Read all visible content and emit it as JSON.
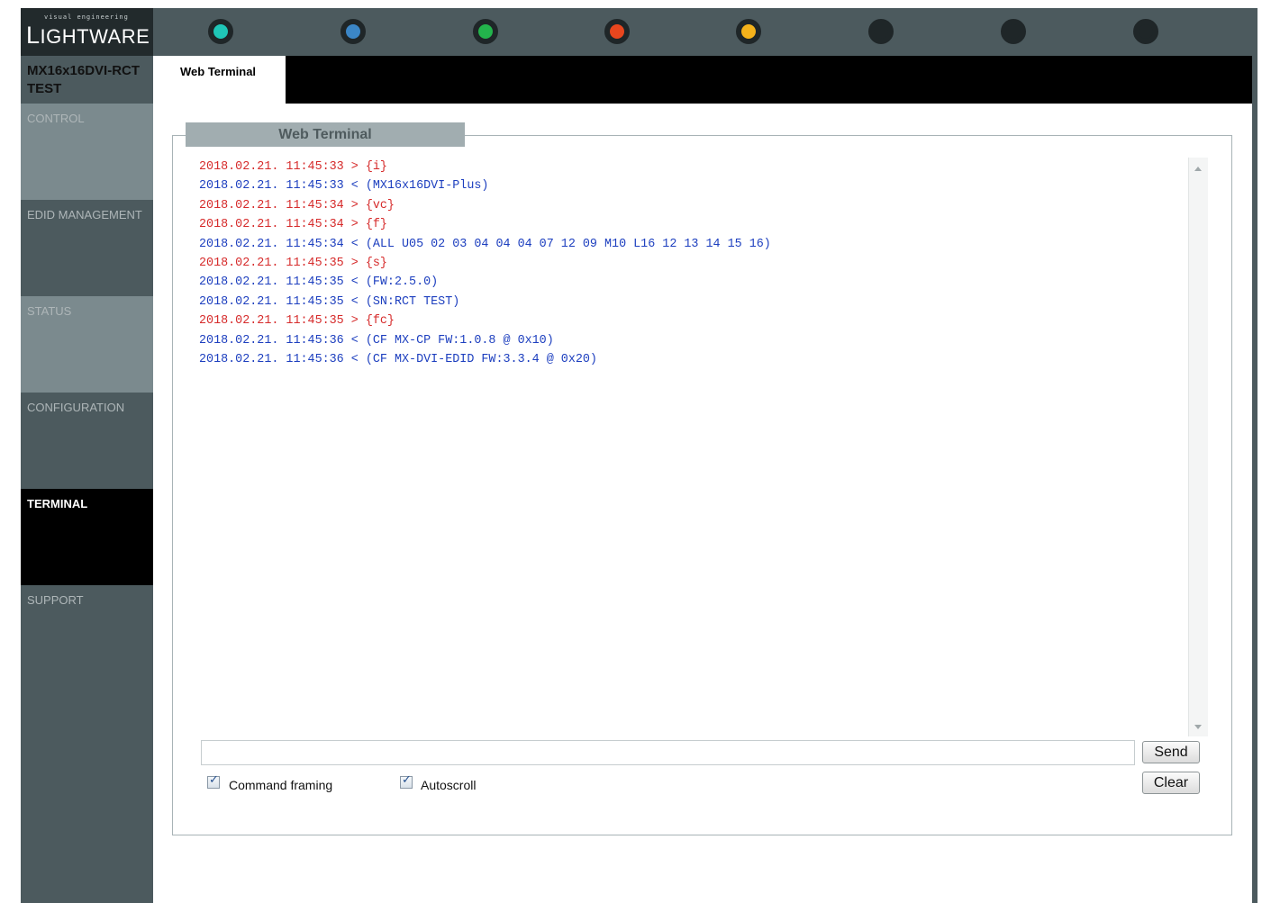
{
  "logo": {
    "tagline": "visual engineering",
    "first_letter": "L",
    "rest": "IGHTWARE"
  },
  "status_dots": [
    {
      "color": "#1fc6b7"
    },
    {
      "color": "#3b86c6"
    },
    {
      "color": "#23b44c"
    },
    {
      "color": "#e8461e"
    },
    {
      "color": "#f4b21b"
    },
    {
      "color": "#1f2628"
    },
    {
      "color": "#1f2628"
    },
    {
      "color": "#1f2628"
    }
  ],
  "device_name": "MX16x16DVI-RCT TEST",
  "menu": [
    "CONTROL",
    "EDID MANAGEMENT",
    "STATUS",
    "CONFIGURATION",
    "TERMINAL",
    "SUPPORT"
  ],
  "active_menu": "TERMINAL",
  "tabs": [
    "Web Terminal"
  ],
  "panel_title": "Web Terminal",
  "colors": {
    "sent": "#d62b2b",
    "received": "#1d3fbf"
  },
  "terminal_lines": [
    {
      "dir": "sent",
      "text": "2018.02.21. 11:45:33 > {i}"
    },
    {
      "dir": "received",
      "text": "2018.02.21. 11:45:33 < (MX16x16DVI-Plus)"
    },
    {
      "dir": "sent",
      "text": "2018.02.21. 11:45:34 > {vc}"
    },
    {
      "dir": "sent",
      "text": "2018.02.21. 11:45:34 > {f}"
    },
    {
      "dir": "received",
      "text": "2018.02.21. 11:45:34 < (ALL U05 02 03 04 04 04 07 12 09 M10 L16 12 13 14 15 16)"
    },
    {
      "dir": "sent",
      "text": "2018.02.21. 11:45:35 > {s}"
    },
    {
      "dir": "received",
      "text": "2018.02.21. 11:45:35 < (FW:2.5.0)"
    },
    {
      "dir": "received",
      "text": "2018.02.21. 11:45:35 < (SN:RCT TEST)"
    },
    {
      "dir": "sent",
      "text": "2018.02.21. 11:45:35 > {fc}"
    },
    {
      "dir": "received",
      "text": "2018.02.21. 11:45:36 < (CF MX-CP FW:1.0.8 @ 0x10)"
    },
    {
      "dir": "received",
      "text": "2018.02.21. 11:45:36 < (CF MX-DVI-EDID FW:3.3.4 @ 0x20)"
    }
  ],
  "command_input": {
    "value": "",
    "placeholder": ""
  },
  "buttons": {
    "send": "Send",
    "clear": "Clear"
  },
  "checkboxes": [
    {
      "label": "Command framing",
      "checked": true
    },
    {
      "label": "Autoscroll",
      "checked": true
    }
  ]
}
